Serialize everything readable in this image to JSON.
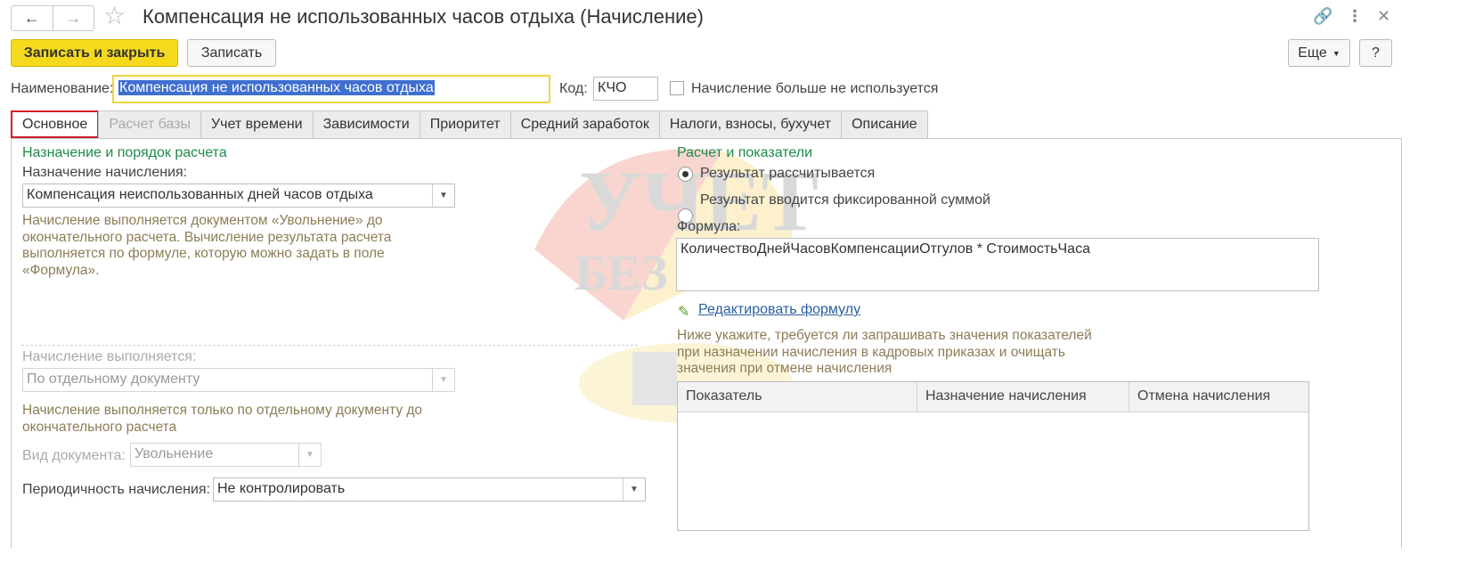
{
  "window": {
    "title": "Компенсация не использованных часов отдыха (Начисление)"
  },
  "toolbar": {
    "save_close_label": "Записать и закрыть",
    "save_label": "Записать",
    "more_label": "Еще",
    "help_label": "?"
  },
  "header": {
    "name_label": "Наименование:",
    "name_value": "Компенсация не использованных часов отдыха",
    "code_label": "Код:",
    "code_value": "КЧО",
    "unused_label": "Начисление больше не используется"
  },
  "tabs": [
    {
      "label": "Основное",
      "state": "active"
    },
    {
      "label": "Расчет базы",
      "state": "disabled"
    },
    {
      "label": "Учет времени"
    },
    {
      "label": "Зависимости"
    },
    {
      "label": "Приоритет"
    },
    {
      "label": "Средний заработок"
    },
    {
      "label": "Налоги, взносы, бухучет"
    },
    {
      "label": "Описание"
    }
  ],
  "left": {
    "group_title": "Назначение и порядок расчета",
    "purpose_label": "Назначение начисления:",
    "purpose_value": "Компенсация неиспользованных дней часов отдыха",
    "purpose_note": "Начисление выполняется документом «Увольнение» до окончательного расчета. Вычисление результата расчета выполняется по формуле, которую можно задать в поле «Формула».",
    "performed_label": "Начисление выполняется:",
    "performed_value": "По отдельному документу",
    "performed_note": "Начисление выполняется только по отдельному документу до окончательного расчета",
    "doc_type_label": "Вид документа:",
    "doc_type_value": "Увольнение",
    "periodicity_label": "Периодичность начисления:",
    "periodicity_value": "Не контролировать"
  },
  "right": {
    "group_title": "Расчет и показатели",
    "radio_calculated": "Результат рассчитывается",
    "radio_fixed": "Результат вводится фиксированной суммой",
    "formula_label": "Формула:",
    "formula_value": "КоличествоДнейЧасовКомпенсацииОтгулов * СтоимостьЧаса",
    "edit_formula_link": "Редактировать формулу",
    "indicators_note": "Ниже укажите, требуется ли запрашивать значения показателей при назначении начисления в кадровых приказах и очищать значения при отмене начисления",
    "table_headers": [
      "Показатель",
      "Назначение начисления",
      "Отмена начисления"
    ]
  },
  "watermark": {
    "line1": "УЧЕТ",
    "line2": "БЕЗ ЗАБОТ"
  },
  "colors": {
    "primary_button": "#f4d91c",
    "group_title": "#1f8a4c",
    "note_text": "#8c7d56",
    "active_tab_border": "#d0202a",
    "link": "#2a5f9e"
  }
}
